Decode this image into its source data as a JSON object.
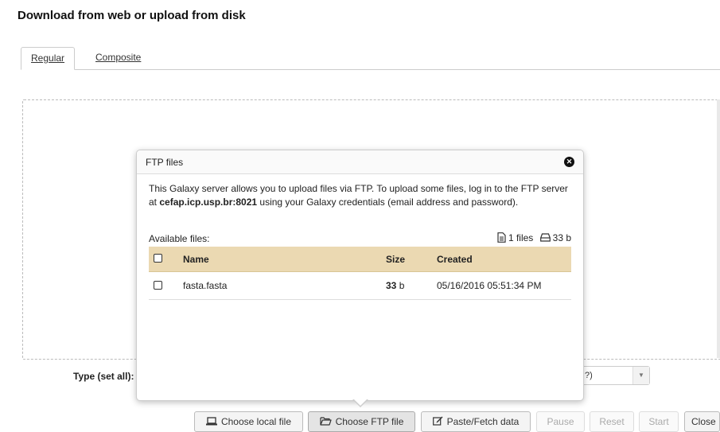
{
  "page": {
    "title": "Download from web or upload from disk",
    "tabs": [
      {
        "label": "Regular",
        "active": true
      },
      {
        "label": "Composite",
        "active": false
      }
    ],
    "type_label": "Type (set all):",
    "genome_value": "?)"
  },
  "popup": {
    "title": "FTP files",
    "message_pre": "This Galaxy server allows you to upload files via FTP. To upload some files, log in to the FTP server at ",
    "server": "cefap.icp.usp.br:8021",
    "message_post": " using your Galaxy credentials (email address and password).",
    "available_label": "Available files:",
    "file_count": "1 files",
    "total_size": "33 b",
    "columns": {
      "name": "Name",
      "size": "Size",
      "created": "Created"
    },
    "files": [
      {
        "name": "fasta.fasta",
        "size_num": "33",
        "size_unit": " b",
        "created": "05/16/2016 05:51:34 PM"
      }
    ]
  },
  "buttons": {
    "choose_local": "Choose local file",
    "choose_ftp": "Choose FTP file",
    "paste_fetch": "Paste/Fetch data",
    "pause": "Pause",
    "reset": "Reset",
    "start": "Start",
    "close": "Close"
  },
  "icons": {
    "laptop": "laptop-icon",
    "folder": "folder-open-icon",
    "edit": "edit-icon",
    "file": "file-icon",
    "drive": "hard-drive-icon",
    "close": "close-circle-icon"
  }
}
